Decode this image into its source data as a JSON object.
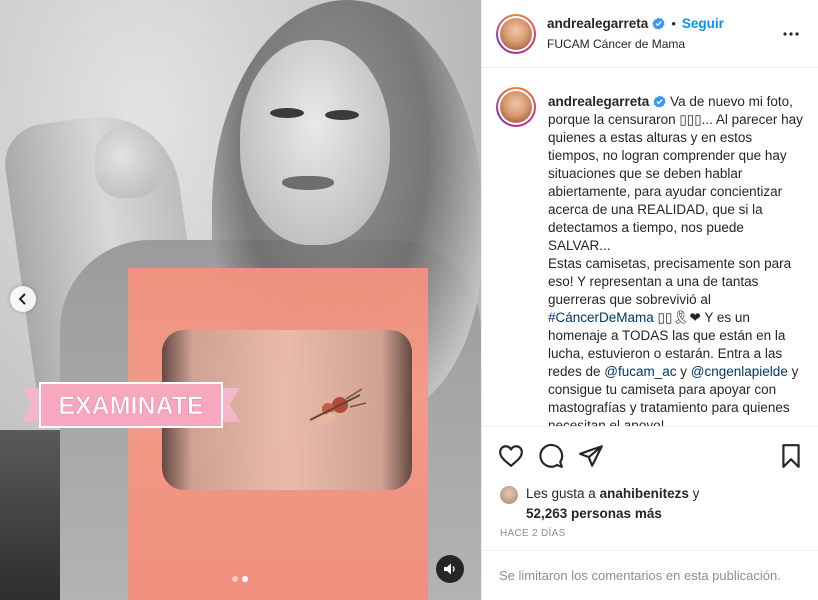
{
  "post": {
    "username": "andrealegarreta",
    "follow_label": "Seguir",
    "follow_separator": "•",
    "location": "FUCAM Cáncer de Mama",
    "sticker_text": "EXAMINATE"
  },
  "caption": {
    "username": "andrealegarreta",
    "text_part1": "Va de nuevo mi foto, porque la censuraron ▯▯▯... Al parecer hay quienes a estas alturas y en estos tiempos, no logran comprender que hay situaciones que se deben hablar abiertamente, para ayudar concientizar acerca de una REALIDAD, que si la detectamos a tiempo, nos puede SALVAR...\nEstas camisetas, precisamente son para eso! Y representan a una de tantas guerreras que sobrevivió al ",
    "hashtag": "#CáncerDeMama",
    "emoji_after_hashtag": " ▯▯🎗❤",
    "text_part2": " Y es un homenaje a TODAS las que están en la lucha, estuvieron o estarán. Entra a las redes de ",
    "mention1": "@fucam_ac",
    "text_part3": " y ",
    "mention2": "@cngenlapielde",
    "text_part4": " y consigue tu camiseta para apoyar con mastografías y tratamiento para quienes necesitan el apoyo!"
  },
  "likes": {
    "prefix": "Les gusta a ",
    "liker": "anahibenitezs",
    "middle": " y",
    "count": "52,263 personas más"
  },
  "timestamp": "HACE 2 DÍAS",
  "comments_notice": "Se limitaron los comentarios en esta publicación.",
  "carousel": {
    "total": 2,
    "active": 2
  },
  "icons": {
    "verified": "verified-badge-icon",
    "more": "more-options-icon",
    "like": "heart-icon",
    "comment": "comment-icon",
    "share": "share-icon",
    "save": "bookmark-icon",
    "prev": "chevron-left-icon",
    "sound": "speaker-icon"
  },
  "colors": {
    "link": "#0095f6",
    "tag": "#00376b",
    "muted": "#8e8e8e",
    "sticker": "#f7a8bf"
  }
}
